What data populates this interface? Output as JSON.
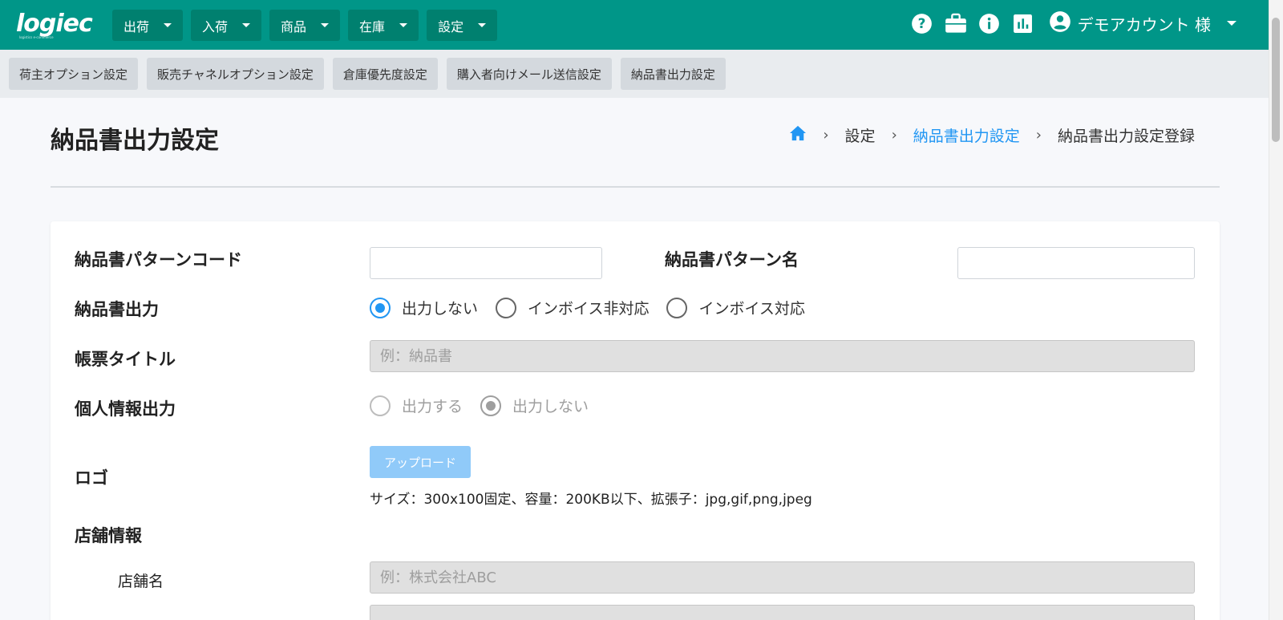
{
  "app": {
    "logo_text": "logiec",
    "logo_tagline": "logistics e-commerce"
  },
  "nav": {
    "menus": [
      {
        "label": "出荷"
      },
      {
        "label": "入荷"
      },
      {
        "label": "商品"
      },
      {
        "label": "在庫"
      },
      {
        "label": "設定"
      }
    ],
    "icons": [
      "help-icon",
      "briefcase-icon",
      "info-icon",
      "bar-chart-icon",
      "account-circle-icon"
    ],
    "account_label": "デモアカウント 様"
  },
  "subnav": {
    "tabs": [
      {
        "label": "荷主オプション設定"
      },
      {
        "label": "販売チャネルオプション設定"
      },
      {
        "label": "倉庫優先度設定"
      },
      {
        "label": "購入者向けメール送信設定"
      },
      {
        "label": "納品書出力設定"
      }
    ]
  },
  "page": {
    "title": "納品書出力設定",
    "breadcrumb": {
      "home_icon": "home-icon",
      "items": [
        "設定",
        "納品書出力設定",
        "納品書出力設定登録"
      ]
    }
  },
  "form": {
    "pattern_code": {
      "label": "納品書パターンコード",
      "value": ""
    },
    "pattern_name": {
      "label": "納品書パターン名",
      "value": ""
    },
    "output": {
      "label": "納品書出力",
      "options": [
        "出力しない",
        "インボイス非対応",
        "インボイス対応"
      ],
      "selected": "出力しない"
    },
    "report_title": {
      "label": "帳票タイトル",
      "placeholder": "例：納品書"
    },
    "personal_info": {
      "label": "個人情報出力",
      "options": [
        "出力する",
        "出力しない"
      ],
      "selected": "出力しない"
    },
    "logo": {
      "label": "ロゴ",
      "upload_label": "アップロード",
      "hint": "サイズ：300x100固定、容量：200KB以下、拡張子：jpg,gif,png,jpeg"
    },
    "store_info": {
      "label": "店舗情報",
      "store_name": {
        "label": "店舗名",
        "placeholder": "例：株式会社ABC"
      }
    }
  },
  "colors": {
    "brand": "#009688",
    "accent": "#2196f3",
    "upload_disabled": "#90caf9"
  }
}
